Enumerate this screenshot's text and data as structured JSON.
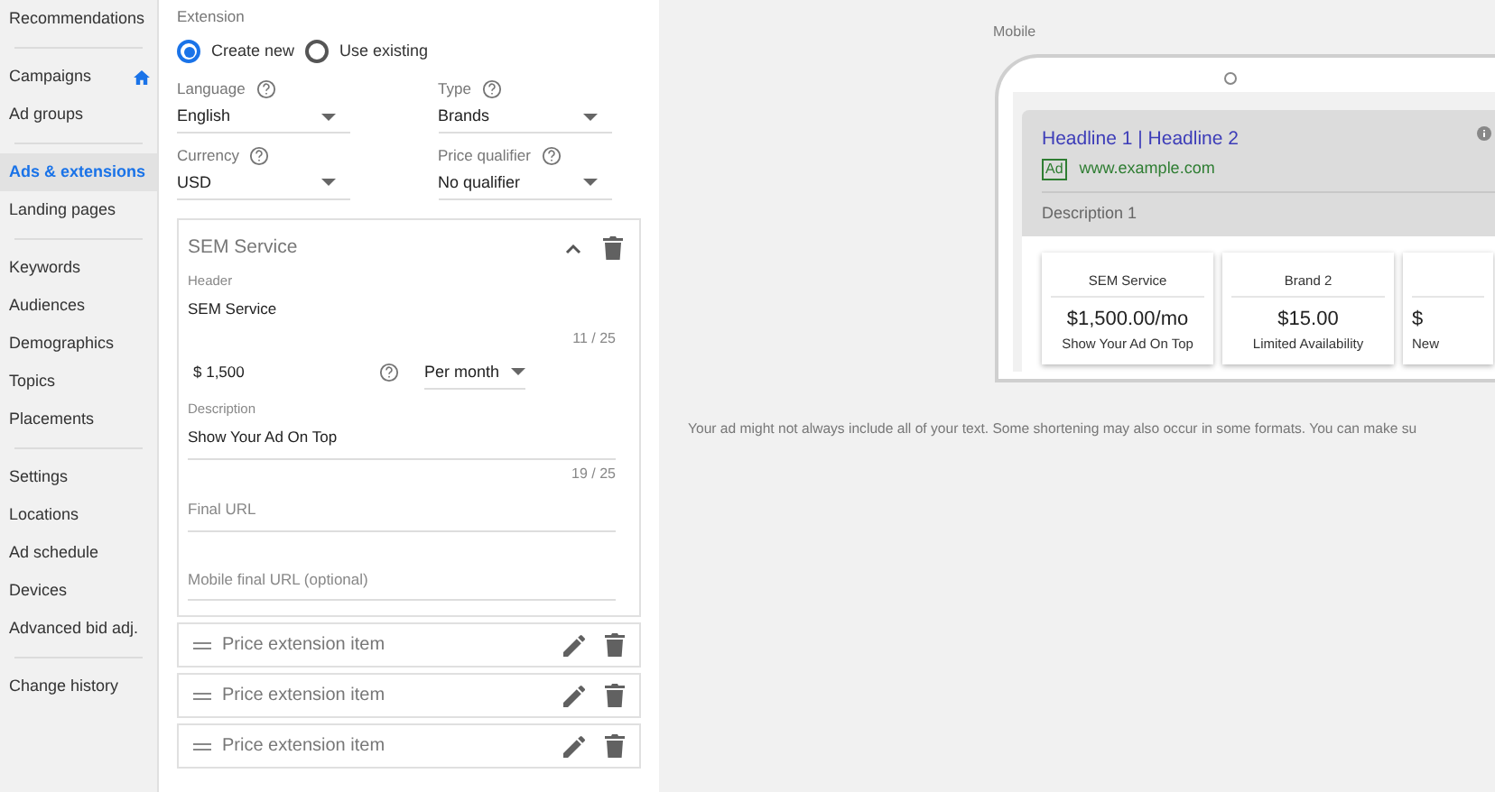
{
  "sidebar": {
    "sections": [
      {
        "items": [
          {
            "label": "Recommendations",
            "selected": false,
            "home": false
          }
        ]
      },
      {
        "items": [
          {
            "label": "Campaigns",
            "selected": false,
            "home": true
          },
          {
            "label": "Ad groups",
            "selected": false,
            "home": false
          }
        ]
      },
      {
        "items": [
          {
            "label": "Ads & extensions",
            "selected": true,
            "home": false
          },
          {
            "label": "Landing pages",
            "selected": false,
            "home": false
          }
        ]
      },
      {
        "items": [
          {
            "label": "Keywords",
            "selected": false,
            "home": false
          },
          {
            "label": "Audiences",
            "selected": false,
            "home": false
          },
          {
            "label": "Demographics",
            "selected": false,
            "home": false
          },
          {
            "label": "Topics",
            "selected": false,
            "home": false
          },
          {
            "label": "Placements",
            "selected": false,
            "home": false
          }
        ]
      },
      {
        "items": [
          {
            "label": "Settings",
            "selected": false,
            "home": false
          },
          {
            "label": "Locations",
            "selected": false,
            "home": false
          },
          {
            "label": "Ad schedule",
            "selected": false,
            "home": false
          },
          {
            "label": "Devices",
            "selected": false,
            "home": false
          },
          {
            "label": "Advanced bid adj.",
            "selected": false,
            "home": false
          }
        ]
      },
      {
        "items": [
          {
            "label": "Change history",
            "selected": false,
            "home": false
          }
        ]
      }
    ]
  },
  "form": {
    "extension_label": "Extension",
    "radios": [
      {
        "label": "Create new",
        "selected": true
      },
      {
        "label": "Use existing",
        "selected": false
      }
    ],
    "selects": [
      {
        "label": "Language",
        "value": "English"
      },
      {
        "label": "Type",
        "value": "Brands"
      },
      {
        "label": "Currency",
        "value": "USD"
      },
      {
        "label": "Price qualifier",
        "value": "No qualifier"
      }
    ],
    "item": {
      "title": "SEM Service",
      "header_label": "Header",
      "header_value": "SEM Service",
      "header_count": "11 / 25",
      "price": "$ 1,500",
      "unit": "Per month",
      "description_label": "Description",
      "description_value": "Show Your Ad On Top",
      "description_count": "19 / 25",
      "final_url_placeholder": "Final URL",
      "mobile_url_placeholder": "Mobile final URL (optional)"
    },
    "collapsed_items": [
      "Price extension item",
      "Price extension item",
      "Price extension item"
    ]
  },
  "preview": {
    "label": "Mobile",
    "headline": "Headline 1 | Headline 2",
    "badge": "Ad",
    "url": "www.example.com",
    "description": "Description 1",
    "cards": [
      {
        "title": "SEM Service",
        "price": "$1,500.00/mo",
        "description": "Show Your Ad On Top"
      },
      {
        "title": "Brand 2",
        "price": "$15.00",
        "description": "Limited Availability"
      },
      {
        "price": "$",
        "description": "New"
      }
    ],
    "note": "Your ad might not always include all of your text. Some shortening may also occur in some formats. You can make su"
  }
}
